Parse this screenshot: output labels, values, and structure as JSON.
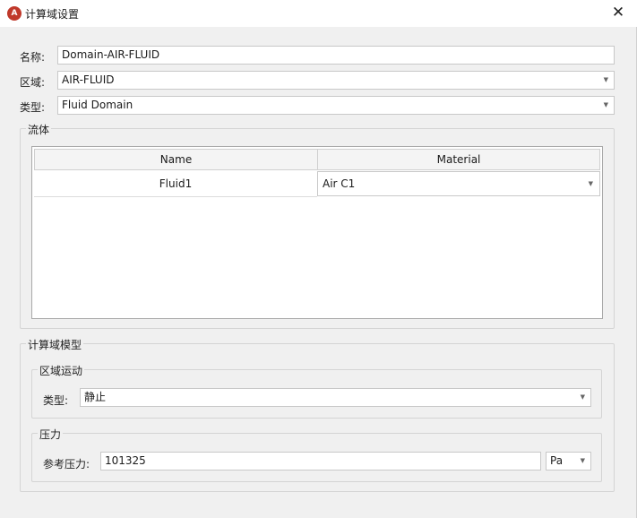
{
  "window": {
    "title": "计算域设置",
    "app_icon_glyph": "A",
    "close_glyph": "✕"
  },
  "form": {
    "name_label": "名称:",
    "name_value": "Domain-AIR-FLUID",
    "region_label": "区域:",
    "region_value": "AIR-FLUID",
    "type_label": "类型:",
    "type_value": "Fluid Domain"
  },
  "fluid_group": {
    "title": "流体",
    "columns": [
      "Name",
      "Material"
    ],
    "rows": [
      {
        "name": "Fluid1",
        "material": "Air C1"
      }
    ]
  },
  "model_group": {
    "title": "计算域模型",
    "motion": {
      "title": "区域运动",
      "type_label": "类型:",
      "type_value": "静止"
    },
    "pressure": {
      "title": "压力",
      "ref_label": "参考压力:",
      "ref_value": "101325",
      "unit_value": "Pa"
    }
  },
  "icons": {
    "app": "app-logo-icon",
    "close": "close-icon",
    "dropdown": "chevron-down-icon"
  },
  "colors": {
    "app_icon": "#c0392b",
    "client_bg": "#f0f0f0"
  }
}
